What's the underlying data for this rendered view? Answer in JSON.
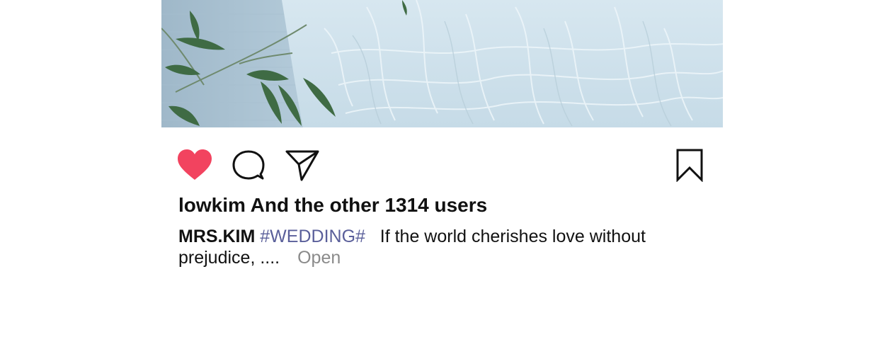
{
  "post": {
    "image_description_icon": "wedding-dress-photo",
    "liked": true,
    "like_color": "#f2435f",
    "likes": {
      "user": "lowkim",
      "rest": "And the other 1314 users"
    },
    "caption": {
      "author": "MRS.KIM",
      "hashtag": "#WEDDING#",
      "text_line1": "If the world cherishes love without",
      "text_line2": "prejudice, ....",
      "open_label": "Open"
    }
  },
  "icons": {
    "like": "heart-icon",
    "comment": "speech-bubble-icon",
    "share": "paper-plane-icon",
    "bookmark": "bookmark-icon"
  },
  "colors": {
    "hashtag": "#5a5f9a",
    "open_link": "#8a8a8a",
    "text": "#111111"
  }
}
